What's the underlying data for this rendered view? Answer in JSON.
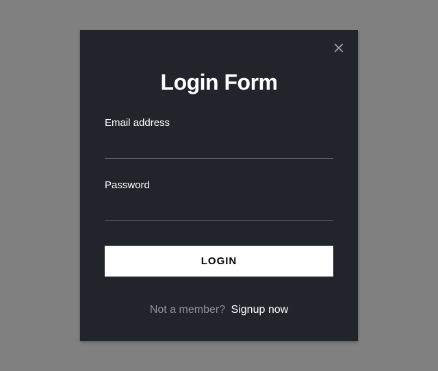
{
  "modal": {
    "title": "Login Form",
    "fields": {
      "email": {
        "label": "Email address",
        "value": ""
      },
      "password": {
        "label": "Password",
        "value": ""
      }
    },
    "submit_label": "LOGIN",
    "signup": {
      "prompt": "Not a member?",
      "link": "Signup now"
    }
  }
}
